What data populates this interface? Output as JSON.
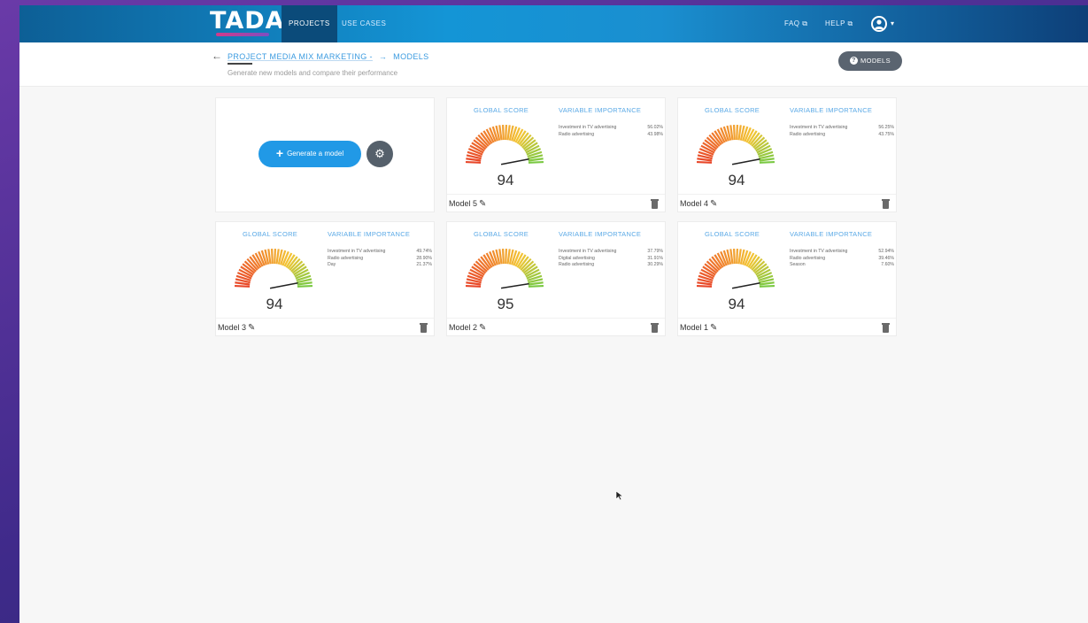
{
  "nav": {
    "logo": "TADA",
    "tabs": [
      {
        "label": "PROJECTS",
        "active": true
      },
      {
        "label": "USE CASES",
        "active": false
      }
    ],
    "faq": "FAQ ⧉",
    "help": "HELP ⧉"
  },
  "header": {
    "back_icon": "back-arrow-icon",
    "breadcrumb_project": "PROJECT MEDIA MIX MARKETING -",
    "breadcrumb_sep": "→",
    "breadcrumb_current": "MODELS",
    "subtitle": "Generate new models and compare their performance",
    "models_button": "MODELS",
    "models_button_icon": "?"
  },
  "generate": {
    "label": "Generate a model",
    "plus": "+",
    "gear": "⚙"
  },
  "labels": {
    "global_score": "GLOBAL SCORE",
    "variable_importance": "VARIABLE IMPORTANCE"
  },
  "models": [
    {
      "name": "Model 5",
      "score": 94,
      "gauge_fraction": 0.94,
      "vars": [
        {
          "name": "Investment in TV advertising",
          "value": "56.02%"
        },
        {
          "name": "Radio advertising",
          "value": "43.98%"
        }
      ]
    },
    {
      "name": "Model 4",
      "score": 94,
      "gauge_fraction": 0.94,
      "vars": [
        {
          "name": "Investment in TV advertising",
          "value": "56.25%"
        },
        {
          "name": "Radio advertising",
          "value": "43.75%"
        }
      ]
    },
    {
      "name": "Model 3",
      "score": 94,
      "gauge_fraction": 0.94,
      "vars": [
        {
          "name": "Investment in TV advertising",
          "value": "49.74%"
        },
        {
          "name": "Radio advertising",
          "value": "28.90%"
        },
        {
          "name": "Day",
          "value": "21.37%"
        }
      ]
    },
    {
      "name": "Model 2",
      "score": 95,
      "gauge_fraction": 0.95,
      "vars": [
        {
          "name": "Investment in TV advertising",
          "value": "37.79%"
        },
        {
          "name": "Digital advertising",
          "value": "31.91%"
        },
        {
          "name": "Radio advertising",
          "value": "30.29%"
        }
      ]
    },
    {
      "name": "Model 1",
      "score": 94,
      "gauge_fraction": 0.94,
      "vars": [
        {
          "name": "Investment in TV advertising",
          "value": "52.94%"
        },
        {
          "name": "Radio advertising",
          "value": "39.46%"
        },
        {
          "name": "Season",
          "value": "7.60%"
        }
      ]
    }
  ],
  "colors": {
    "accent": "#2199e6",
    "gauge_low": "#e8472a",
    "gauge_mid": "#f3c534",
    "gauge_high": "#7ac943"
  }
}
